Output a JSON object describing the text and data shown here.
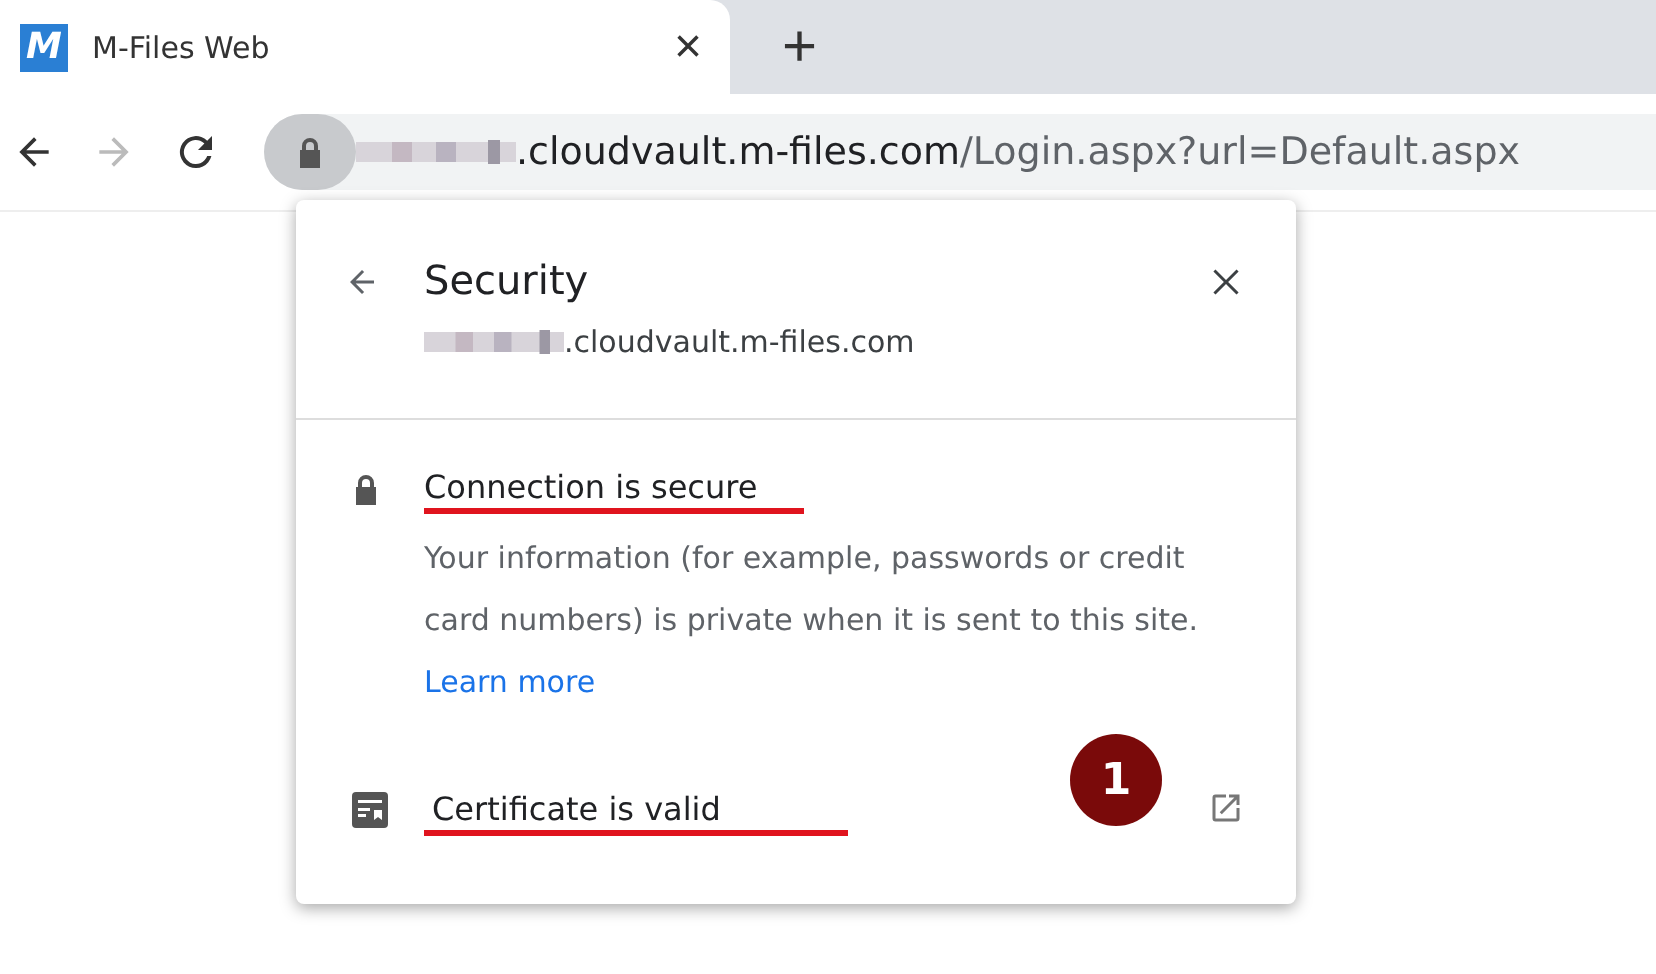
{
  "tab": {
    "title": "M-Files Web",
    "favicon": "M",
    "close": "×"
  },
  "new_tab": "+",
  "address_bar": {
    "domain": ".cloudvault.m-files.com",
    "path": "/Login.aspx?url=Default.aspx"
  },
  "popup": {
    "title": "Security",
    "site": ".cloudvault.m-files.com",
    "connection": {
      "title": "Connection is secure",
      "text": "Your information (for example, passwords or credit card numbers) is private when it is sent to this site.",
      "link": "Learn more"
    },
    "certificate": {
      "title": "Certificate is valid"
    },
    "badge": "1"
  }
}
